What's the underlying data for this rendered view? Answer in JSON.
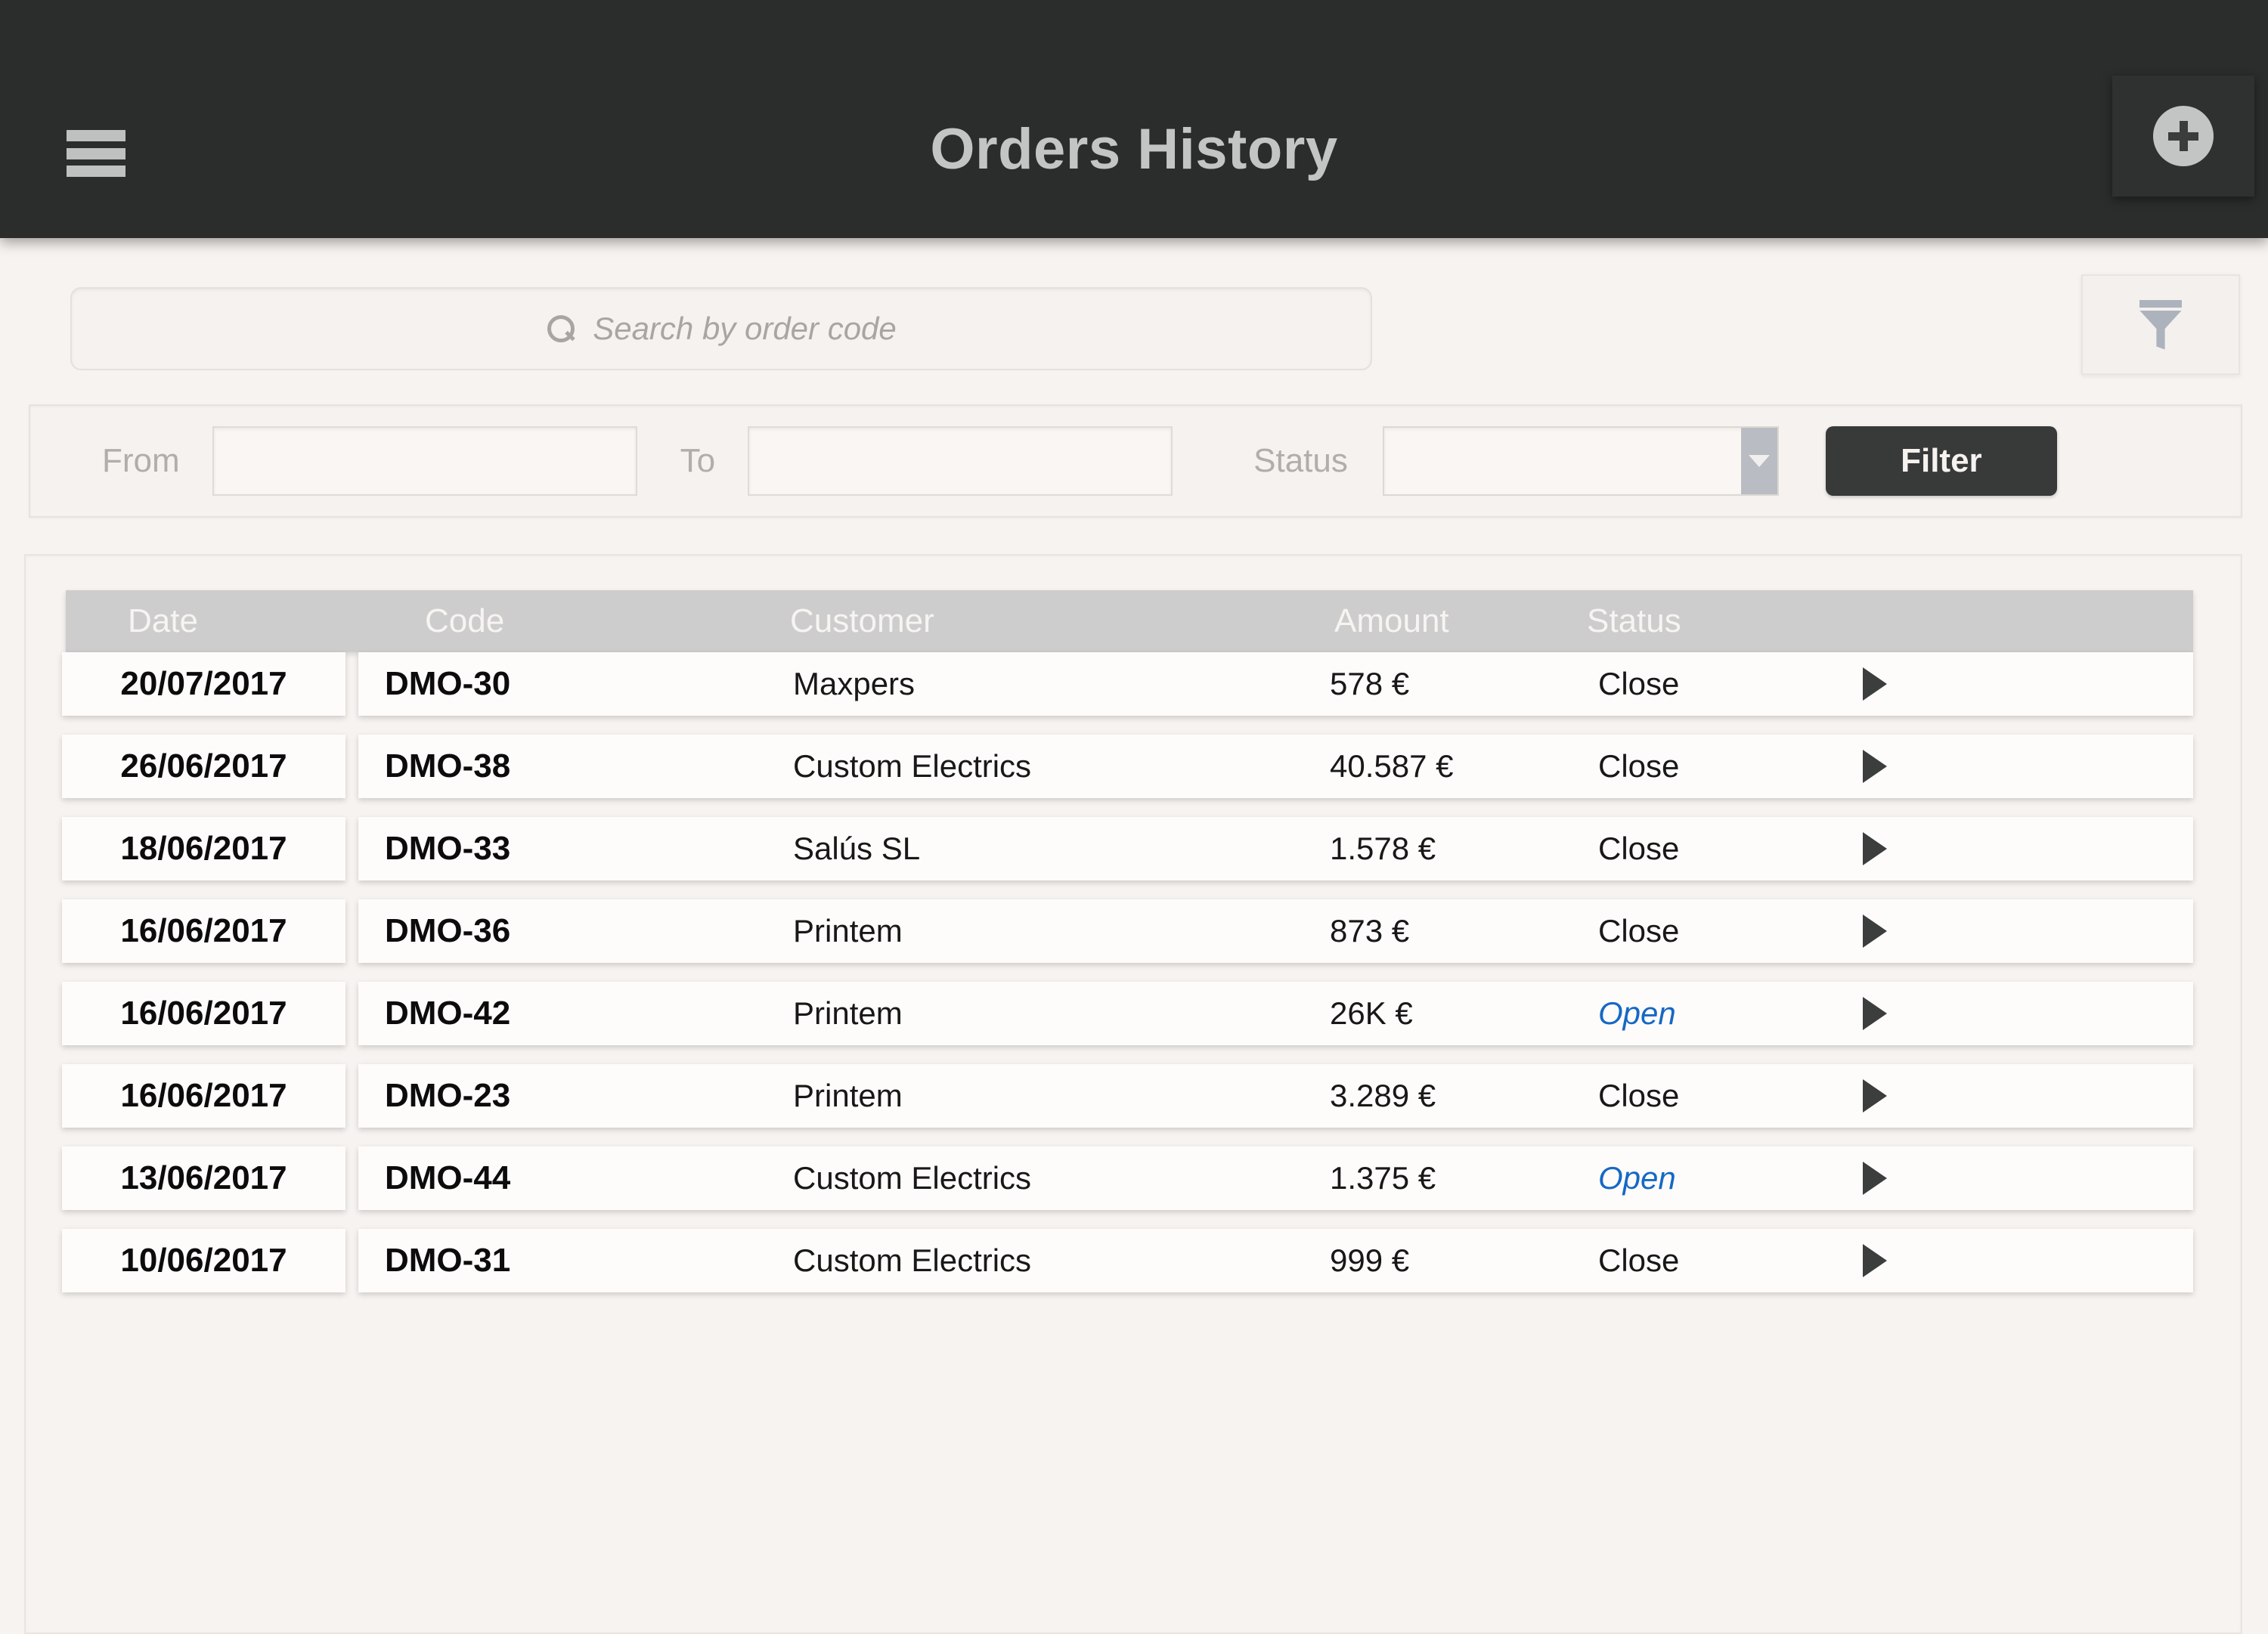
{
  "appbar": {
    "title": "Orders History",
    "menu_icon": "hamburger-menu-icon",
    "add_icon": "plus-circle-icon"
  },
  "search": {
    "placeholder": "Search by order code",
    "value": "",
    "icon": "search-icon",
    "filter_toggle_icon": "funnel-icon"
  },
  "filterbar": {
    "from_label": "From",
    "from_value": "",
    "to_label": "To",
    "to_value": "",
    "status_label": "Status",
    "status_value": "",
    "status_arrow_icon": "chevron-down-icon",
    "filter_button": "Filter"
  },
  "table": {
    "columns": [
      "Date",
      "Code",
      "Customer",
      "Amount",
      "Status"
    ],
    "rows": [
      {
        "date": "20/07/2017",
        "code": "DMO-30",
        "customer": "Maxpers",
        "amount": "578 €",
        "status": "Close",
        "open": false
      },
      {
        "date": "26/06/2017",
        "code": "DMO-38",
        "customer": "Custom Electrics",
        "amount": "40.587 €",
        "status": "Close",
        "open": false
      },
      {
        "date": "18/06/2017",
        "code": "DMO-33",
        "customer": "Salús SL",
        "amount": "1.578 €",
        "status": "Close",
        "open": false
      },
      {
        "date": "16/06/2017",
        "code": "DMO-36",
        "customer": "Printem",
        "amount": "873 €",
        "status": "Close",
        "open": false
      },
      {
        "date": "16/06/2017",
        "code": "DMO-42",
        "customer": "Printem",
        "amount": "26K €",
        "status": "Open",
        "open": true
      },
      {
        "date": "16/06/2017",
        "code": "DMO-23",
        "customer": "Printem",
        "amount": "3.289 €",
        "status": "Close",
        "open": false
      },
      {
        "date": "13/06/2017",
        "code": "DMO-44",
        "customer": "Custom Electrics",
        "amount": "1.375 €",
        "status": "Open",
        "open": true
      },
      {
        "date": "10/06/2017",
        "code": "DMO-31",
        "customer": "Custom Electrics",
        "amount": "999 €",
        "status": "Close",
        "open": false
      }
    ],
    "row_chevron_icon": "chevron-right-icon"
  },
  "colors": {
    "appbar_bg": "#2b2d2c",
    "page_bg": "#f7f3f0",
    "card_bg": "#fdfcfb",
    "header_row_bg": "#cdcdcd",
    "open_status": "#1668c4",
    "filter_button_bg": "#383a39",
    "muted_text": "#b0aeab"
  }
}
